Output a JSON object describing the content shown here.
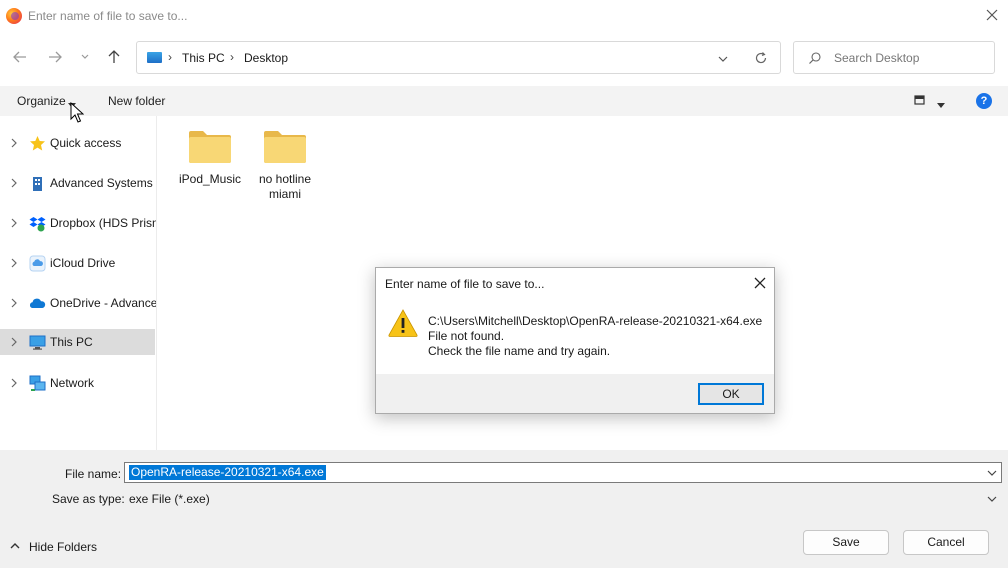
{
  "window": {
    "title": "Enter name of file to save to...",
    "icon": "firefox-icon"
  },
  "address_bar": {
    "breadcrumbs": [
      "This PC",
      "Desktop"
    ],
    "icon": "computer-icon"
  },
  "search": {
    "placeholder": "Search Desktop"
  },
  "command_bar": {
    "organize_label": "Organize",
    "new_folder_label": "New folder"
  },
  "sidebar": {
    "items": [
      {
        "label": "Quick access",
        "icon": "star-icon"
      },
      {
        "label": "Advanced Systems D",
        "icon": "building-icon"
      },
      {
        "label": "Dropbox (HDS Prism",
        "icon": "dropbox-icon"
      },
      {
        "label": "iCloud Drive",
        "icon": "icloud-icon"
      },
      {
        "label": "OneDrive - Advance",
        "icon": "onedrive-icon"
      },
      {
        "label": "This PC",
        "icon": "computer-icon",
        "selected": true
      },
      {
        "label": "Network",
        "icon": "network-icon"
      }
    ]
  },
  "content": {
    "folders": [
      {
        "name": "iPod_Music"
      },
      {
        "name": "no hotline miami"
      }
    ]
  },
  "footer": {
    "file_name_label": "File name:",
    "file_name_value": "OpenRA-release-20210321-x64.exe",
    "save_type_label": "Save as type:",
    "save_type_value": "exe File (*.exe)",
    "hide_folders_label": "Hide Folders",
    "save_label": "Save",
    "cancel_label": "Cancel"
  },
  "dialog": {
    "title": "Enter name of file to save to...",
    "lines": [
      "C:\\Users\\Mitchell\\Desktop\\OpenRA-release-20210321-x64.exe",
      "File not found.",
      "Check the file name and try again."
    ],
    "ok_label": "OK",
    "icon": "warning-icon"
  },
  "colors": {
    "accent": "#0078d7",
    "folder": "#f8d775",
    "help": "#1a73e8"
  }
}
